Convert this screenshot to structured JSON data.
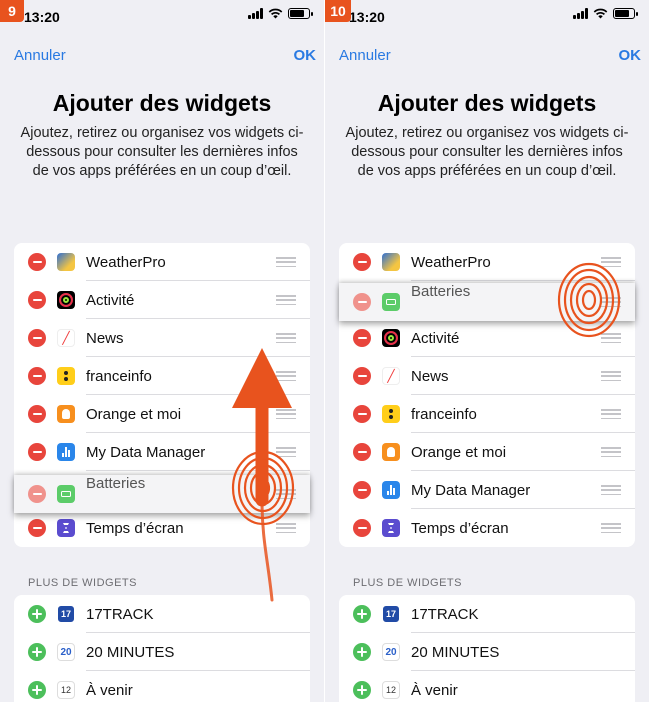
{
  "steps": [
    "9",
    "10"
  ],
  "status": {
    "time": "13:20",
    "location_icon": "location-arrow-icon"
  },
  "nav": {
    "cancel": "Annuler",
    "ok": "OK"
  },
  "header": {
    "title": "Ajouter des widgets",
    "description": "Ajoutez, retirez ou organisez vos widgets ci-dessous pour consulter les dernières infos de vos apps préférées en un coup d’œil."
  },
  "section_more": "PLUS DE WIDGETS",
  "panel1": {
    "widgets": [
      {
        "label": "WeatherPro",
        "icon": "weatherpro-icon"
      },
      {
        "label": "Activité",
        "icon": "activity-icon"
      },
      {
        "label": "News",
        "icon": "news-icon"
      },
      {
        "label": "franceinfo",
        "icon": "franceinfo-icon"
      },
      {
        "label": "Orange et moi",
        "icon": "orange-icon"
      },
      {
        "label": "My Data Manager",
        "icon": "data-manager-icon"
      },
      {
        "label": "Batteries",
        "icon": "batteries-icon",
        "dragging": true
      },
      {
        "label": "Temps d’écran",
        "icon": "screen-time-icon"
      }
    ]
  },
  "panel2": {
    "widgets": [
      {
        "label": "WeatherPro",
        "icon": "weatherpro-icon"
      },
      {
        "label": "Batteries",
        "icon": "batteries-icon",
        "dragging": true
      },
      {
        "label": "Activité",
        "icon": "activity-icon"
      },
      {
        "label": "News",
        "icon": "news-icon"
      },
      {
        "label": "franceinfo",
        "icon": "franceinfo-icon"
      },
      {
        "label": "Orange et moi",
        "icon": "orange-icon"
      },
      {
        "label": "My Data Manager",
        "icon": "data-manager-icon"
      },
      {
        "label": "Temps d’écran",
        "icon": "screen-time-icon"
      }
    ]
  },
  "more_widgets": [
    {
      "label": "17TRACK",
      "icon": "17track-icon",
      "glyph": "17"
    },
    {
      "label": "20 MINUTES",
      "icon": "20minutes-icon",
      "glyph": "20"
    },
    {
      "label": "À venir",
      "icon": "calendar-icon",
      "glyph": "12"
    }
  ],
  "colors": {
    "accent": "#2a7ae2",
    "remove": "#e8453c",
    "add": "#4cbf5b",
    "badge": "#e8531e",
    "gesture": "#e8531e"
  }
}
